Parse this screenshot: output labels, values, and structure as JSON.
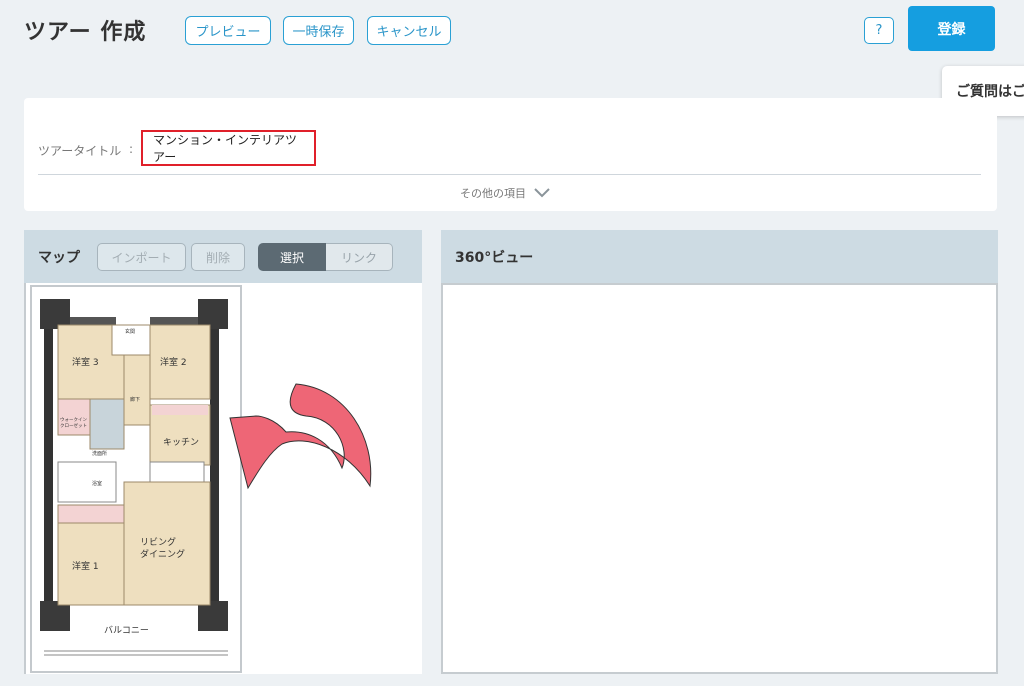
{
  "header": {
    "title": "ツアー 作成",
    "preview_label": "プレビュー",
    "temp_save_label": "一時保存",
    "cancel_label": "キャンセル",
    "help_label": "?",
    "register_label": "登録",
    "question_tab": "ご質問はご"
  },
  "tour": {
    "title_label": "ツアータイトル",
    "colon": ":",
    "title_value": "マンション・インテリアツアー",
    "more_label": "その他の項目"
  },
  "map": {
    "heading": "マップ",
    "import_label": "インポート",
    "delete_label": "削除",
    "select_label": "選択",
    "link_label": "リンク",
    "floorplan": {
      "room_western3": "洋室 3",
      "room_western2": "洋室 2",
      "room_western1": "洋室 1",
      "entrance": "玄関",
      "hallway": "廊下",
      "kitchen": "キッチン",
      "walkin_line1": "ウォークイン",
      "walkin_line2": "クローゼット",
      "washroom": "洗面所",
      "bathroom": "浴室",
      "living_line1": "リビング",
      "living_line2": "ダイニング",
      "balcony": "バルコニー"
    }
  },
  "view": {
    "heading": "360°ビュー"
  },
  "colors": {
    "accent": "#159ee0",
    "highlight": "#e0202a",
    "arrow": "#ee6676"
  }
}
